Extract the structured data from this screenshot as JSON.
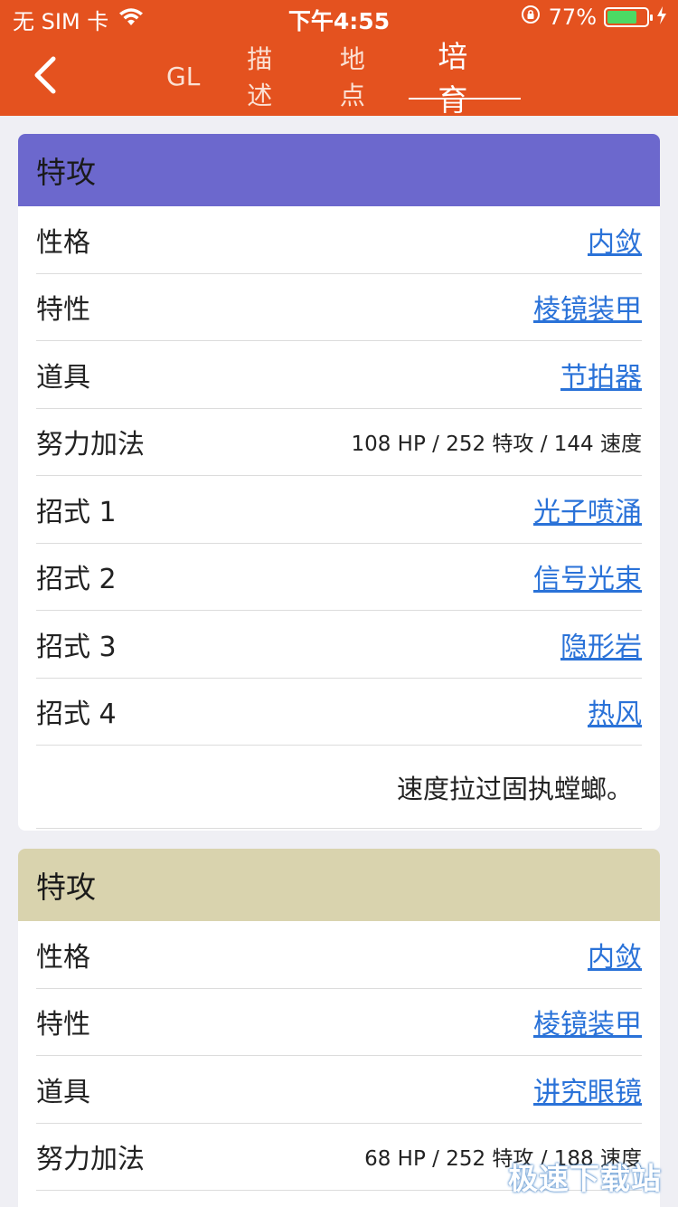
{
  "status_bar": {
    "carrier": "无 SIM 卡",
    "time": "下午4:55",
    "battery_percent": "77%",
    "battery_level": 0.77
  },
  "nav": {
    "tabs": [
      {
        "label": "GL",
        "active": false
      },
      {
        "label": "描述",
        "active": false
      },
      {
        "label": "地点",
        "active": false
      },
      {
        "label": "培育",
        "active": true
      }
    ]
  },
  "cards": [
    {
      "title": "特攻",
      "header_color": "#6c68cd",
      "rows": [
        {
          "label": "性格",
          "value": "内敛",
          "link": true
        },
        {
          "label": "特性",
          "value": "棱镜装甲",
          "link": true
        },
        {
          "label": "道具",
          "value": "节拍器",
          "link": true
        },
        {
          "label": "努力加法",
          "value": "108 HP / 252 特攻 / 144 速度",
          "link": false
        },
        {
          "label": "招式 1",
          "value": "光子喷涌",
          "link": true
        },
        {
          "label": "招式 2",
          "value": "信号光束",
          "link": true
        },
        {
          "label": "招式 3",
          "value": "隐形岩",
          "link": true
        },
        {
          "label": "招式 4",
          "value": "热风",
          "link": true
        }
      ],
      "note": "速度拉过固执螳螂。"
    },
    {
      "title": "特攻",
      "header_color": "#d9d3ae",
      "rows": [
        {
          "label": "性格",
          "value": "内敛",
          "link": true
        },
        {
          "label": "特性",
          "value": "棱镜装甲",
          "link": true
        },
        {
          "label": "道具",
          "value": "讲究眼镜",
          "link": true
        },
        {
          "label": "努力加法",
          "value": "68 HP / 252 特攻 / 188 速度",
          "link": false
        }
      ]
    }
  ],
  "watermark": "极速下载站",
  "colors": {
    "accent": "#e4521f",
    "link": "#2a72d8"
  }
}
